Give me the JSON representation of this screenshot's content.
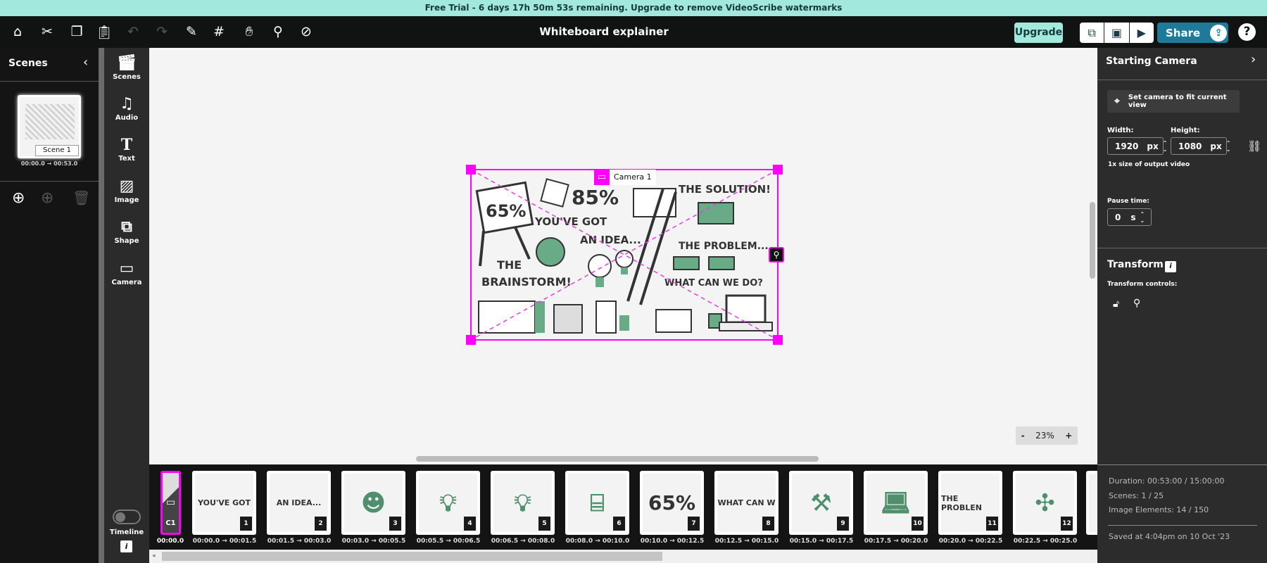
{
  "banner": "Free Trial - 6 days 17h 50m 53s remaining. Upgrade to remove VideoScribe watermarks",
  "toolbar": {
    "title": "Whiteboard explainer",
    "upgrade": "Upgrade",
    "share": "Share",
    "help": "?",
    "icons": [
      "home-icon",
      "scissors-icon",
      "copy-icon",
      "paste-icon",
      "undo-icon",
      "redo-icon",
      "draw-icon",
      "grid-icon",
      "hand-icon",
      "pin-icon",
      "hide-icon"
    ]
  },
  "scenes_panel": {
    "title": "Scenes",
    "scene_label": "Scene 1",
    "start": "00:00.0",
    "arrow": "→",
    "end": "00:53.0"
  },
  "tools": [
    "Scenes",
    "Audio",
    "Text",
    "Image",
    "Shape",
    "Camera"
  ],
  "timeline_toggle": {
    "label": "Timeline",
    "info": "i"
  },
  "canvas": {
    "camera_label": "Camera 1",
    "zoom": "23%",
    "zoom_minus": "-",
    "zoom_plus": "+",
    "illustration_text": [
      "65%",
      "85%",
      "YOU'VE GOT",
      "AN IDEA...",
      "THE",
      "BRAINSTORM!",
      "THE SOLUTION!",
      "THE PROBLEM...",
      "WHAT CAN WE DO?"
    ]
  },
  "right_panel": {
    "title": "Starting Camera",
    "fit_button": "Set camera to fit current view",
    "width_label": "Width:",
    "width": "1920",
    "height_label": "Height:",
    "height": "1080",
    "unit": "px",
    "size_note": "1x size of output video",
    "pause_label": "Pause time:",
    "pause": "0",
    "pause_unit": "s",
    "transform_title": "Transform",
    "transform_info": "i",
    "transform_controls": "Transform controls:",
    "duration": "Duration: 00:53:00 / 15:00:00",
    "scenes_count": "Scenes: 1 / 25",
    "image_elements": "Image Elements: 14 / 150",
    "saved": "Saved at 4:04pm on 10 Oct '23"
  },
  "timeline": {
    "camera": {
      "label": "C1",
      "time": "00:00.0"
    },
    "items": [
      {
        "n": "1",
        "text": "YOU'VE GOT",
        "icon": null,
        "start": "00:00.0",
        "end": "00:01.5"
      },
      {
        "n": "2",
        "text": "AN IDEA...",
        "icon": null,
        "start": "00:01.5",
        "end": "00:03.0"
      },
      {
        "n": "3",
        "text": null,
        "icon": "head-brain",
        "start": "00:03.0",
        "end": "00:05.5"
      },
      {
        "n": "4",
        "text": null,
        "icon": "lightbulb",
        "start": "00:05.5",
        "end": "00:06.5"
      },
      {
        "n": "5",
        "text": null,
        "icon": "lightbulb",
        "start": "00:06.5",
        "end": "00:08.0"
      },
      {
        "n": "6",
        "text": null,
        "icon": "easel",
        "start": "00:08.0",
        "end": "00:10.0"
      },
      {
        "n": "7",
        "text": "65%",
        "icon": null,
        "start": "00:10.0",
        "end": "00:12.5"
      },
      {
        "n": "8",
        "text": "WHAT CAN W",
        "icon": null,
        "start": "00:12.5",
        "end": "00:15.0"
      },
      {
        "n": "9",
        "text": null,
        "icon": "toolbox",
        "start": "00:15.0",
        "end": "00:17.5"
      },
      {
        "n": "10",
        "text": null,
        "icon": "laptop",
        "start": "00:17.5",
        "end": "00:20.0"
      },
      {
        "n": "11",
        "text": "THE PROBLEN",
        "icon": null,
        "start": "00:20.0",
        "end": "00:22.5"
      },
      {
        "n": "12",
        "text": null,
        "icon": "puzzle",
        "start": "00:22.5",
        "end": "00:25.0"
      }
    ]
  },
  "colors": {
    "accent": "#a3e8dc",
    "share": "#1f7a99",
    "camera": "#ff00ff",
    "green": "#5fa37f"
  }
}
